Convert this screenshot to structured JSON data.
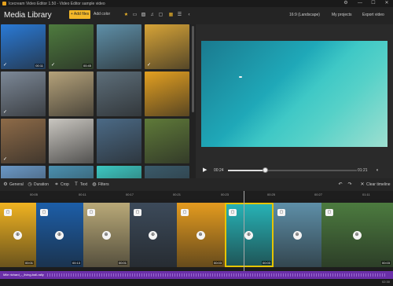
{
  "window": {
    "title": "Icecream Video Editor 1.50 - Video Editor sample video",
    "controls": [
      "⚙",
      "—",
      "☐",
      "✕"
    ]
  },
  "library": {
    "title": "Media Library",
    "add_files": "+ Add files",
    "add_color": "Add color",
    "toolbar_icons": [
      "star-icon",
      "video-icon",
      "image-icon",
      "music-icon",
      "folder-icon",
      "grid-icon",
      "list-icon",
      "collapse-icon"
    ],
    "thumbs": [
      {
        "color": "#2a7ad6",
        "dur": "00:11",
        "check": true
      },
      {
        "color": "#4e7b3e",
        "dur": "00:45",
        "check": true
      },
      {
        "color": "#5e8fa8",
        "dur": "",
        "check": false
      },
      {
        "color": "#d7a437",
        "dur": "",
        "check": true
      },
      {
        "color": "#7c8897",
        "dur": "",
        "check": true
      },
      {
        "color": "#b5a27a",
        "dur": "",
        "check": false
      },
      {
        "color": "#5d6e7a",
        "dur": "",
        "check": false
      },
      {
        "color": "#e3a021",
        "dur": "",
        "check": false
      },
      {
        "color": "#8e6b48",
        "dur": "",
        "check": true
      },
      {
        "color": "#c9c6c0",
        "dur": "",
        "check": false
      },
      {
        "color": "#4b6a86",
        "dur": "",
        "check": false
      },
      {
        "color": "#5f7a39",
        "dur": "",
        "check": false
      },
      {
        "color": "#6a98c6",
        "dur": "",
        "check": false
      },
      {
        "color": "#4a90b0",
        "dur": "",
        "check": false
      },
      {
        "color": "#3cc7c2",
        "dur": "",
        "check": false
      },
      {
        "color": "#3a5a6a",
        "dur": "",
        "check": false
      }
    ]
  },
  "header_right": {
    "aspect": "16:9 (Landscape)",
    "my_projects": "My projects",
    "export": "Export video"
  },
  "player": {
    "current": "00:24",
    "end": "01:21",
    "progress": 0.29
  },
  "toolbar": {
    "general": "General",
    "duration": "Duration",
    "crop": "Crop",
    "text": "Text",
    "filters": "Filters",
    "clear": "Clear timeline"
  },
  "ruler": [
    "00:05",
    "00:11",
    "00:17",
    "00:21",
    "00:23",
    "00:25",
    "00:27",
    "01:11"
  ],
  "timeline": {
    "clips": [
      {
        "color": "#f0b321",
        "dur": "00:01"
      },
      {
        "color": "#1c5ea8",
        "dur": "00:13"
      },
      {
        "color": "#b9a978",
        "dur": "00:01"
      },
      {
        "color": "#3c4a5a",
        "dur": ""
      },
      {
        "color": "#e49b1f",
        "dur": "00:03"
      },
      {
        "color": "#27b4b8",
        "dur": "00:03"
      },
      {
        "color": "#5e8fa8",
        "dur": ""
      },
      {
        "color": "#4c7b3f",
        "dur": "00:03"
      }
    ]
  },
  "audio": {
    "label": "Mile richard_-_living-ball-rally",
    "end": "02:30"
  }
}
